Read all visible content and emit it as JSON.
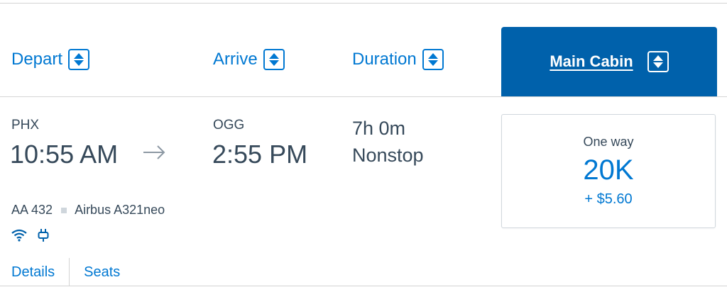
{
  "header": {
    "depart_label": "Depart",
    "arrive_label": "Arrive",
    "duration_label": "Duration",
    "cabin_label": "Main Cabin"
  },
  "flight": {
    "origin_code": "PHX",
    "depart_time": "10:55 AM",
    "destination_code": "OGG",
    "arrive_time": "2:55 PM",
    "duration": "7h 0m",
    "stops": "Nonstop",
    "flight_number": "AA 432",
    "aircraft": "Airbus A321neo",
    "amenities": [
      "wifi-icon",
      "power-outlet-icon"
    ]
  },
  "links": {
    "details": "Details",
    "seats": "Seats"
  },
  "price": {
    "trip_type": "One way",
    "miles": "20K",
    "taxes": "+ $5.60"
  },
  "colors": {
    "accent": "#0078d2",
    "cabin_tab": "#0061ab",
    "text": "#36495a",
    "divider": "#d4d4d4"
  }
}
